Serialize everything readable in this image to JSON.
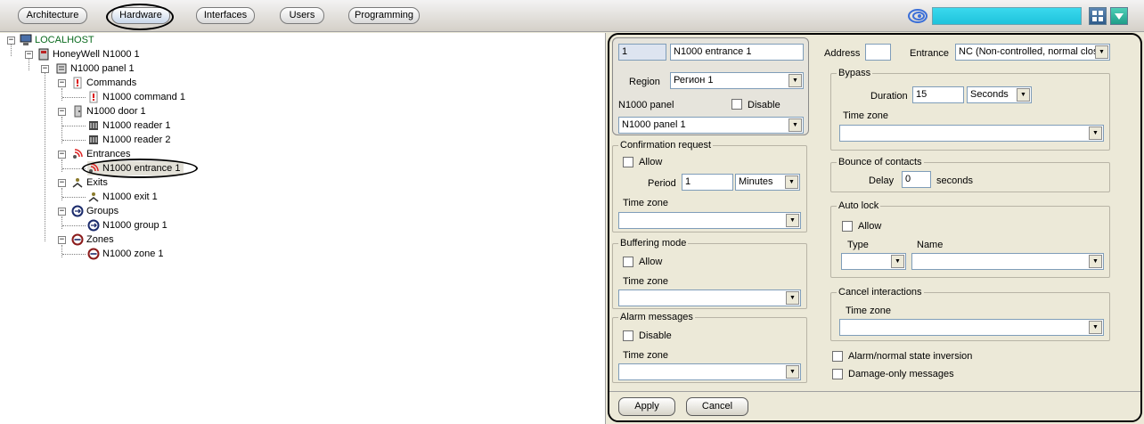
{
  "toolbar": {
    "tabs": [
      "Architecture",
      "Hardware",
      "Interfaces",
      "Users",
      "Programming"
    ]
  },
  "tree": {
    "items": [
      "LOCALHOST",
      "HoneyWell N1000 1",
      "N1000 panel 1",
      "Commands",
      "N1000 command 1",
      "N1000 door 1",
      "N1000 reader 1",
      "N1000 reader 2",
      "Entrances",
      "N1000 entrance 1",
      "Exits",
      "N1000 exit 1",
      "Groups",
      "N1000 group 1",
      "Zones",
      "N1000 zone 1"
    ]
  },
  "form": {
    "id_value": "1",
    "name_value": "N1000 entrance 1",
    "region_label": "Region",
    "region_value": "Регион 1",
    "panel_label": "N1000 panel",
    "disable_label": "Disable",
    "panel_value": "N1000 panel 1",
    "confirmation": {
      "title": "Confirmation request",
      "allow_label": "Allow",
      "period_label": "Period",
      "period_value": "1",
      "period_unit": "Minutes",
      "timezone_label": "Time zone"
    },
    "buffering": {
      "title": "Buffering mode",
      "allow_label": "Allow",
      "timezone_label": "Time zone"
    },
    "alarm": {
      "title": "Alarm messages",
      "disable_label": "Disable",
      "timezone_label": "Time zone"
    },
    "address_label": "Address",
    "entrance_label": "Entrance",
    "entrance_value": "NC (Non-controlled, normal close",
    "bypass": {
      "title": "Bypass",
      "duration_label": "Duration",
      "duration_value": "15",
      "duration_unit": "Seconds",
      "timezone_label": "Time zone"
    },
    "bounce": {
      "title": "Bounce of contacts",
      "delay_label": "Delay",
      "delay_value": "0",
      "unit_label": "seconds"
    },
    "autolock": {
      "title": "Auto lock",
      "allow_label": "Allow",
      "type_label": "Type",
      "name_label": "Name"
    },
    "cancel_interactions": {
      "title": "Cancel interactions",
      "timezone_label": "Time zone"
    },
    "inversion_label": "Alarm/normal state inversion",
    "damage_label": "Damage-only messages",
    "apply_label": "Apply",
    "cancel_label": "Cancel"
  }
}
